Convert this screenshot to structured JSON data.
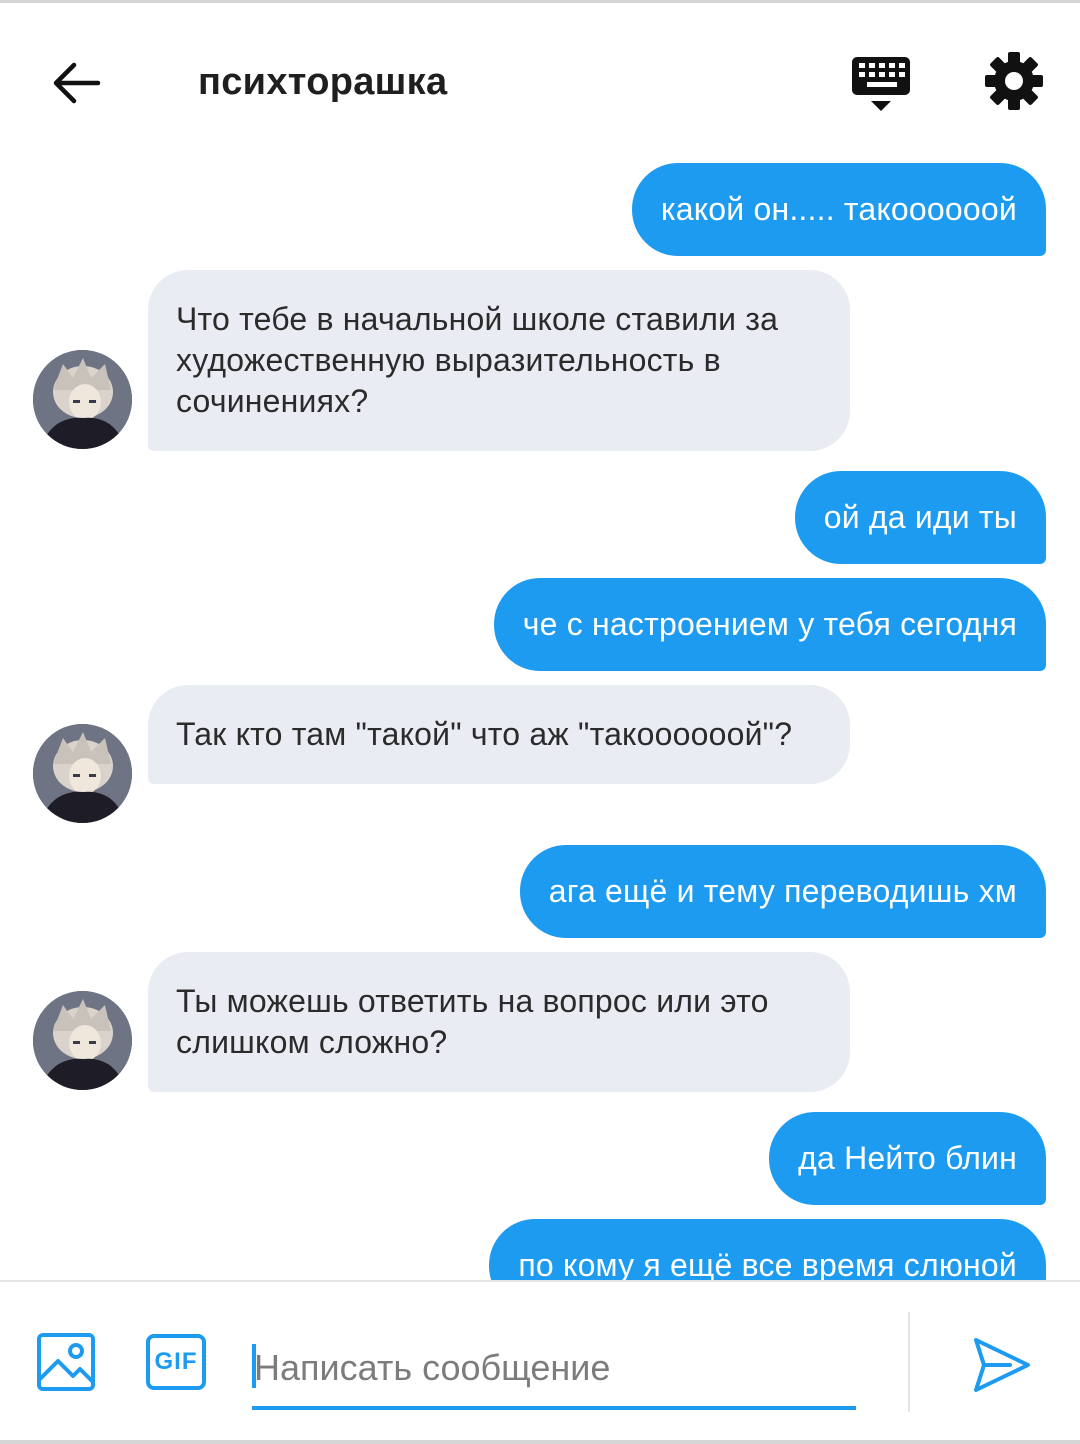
{
  "header": {
    "title": "психторашка",
    "back_icon": "arrow-left-icon",
    "keyboard_icon": "keyboard-hide-icon",
    "settings_icon": "gear-icon"
  },
  "messages": [
    {
      "side": "out",
      "text": "какой он..... такоооооой"
    },
    {
      "side": "in",
      "text": "Что тебе в начальной школе ставили за художественную выразительность в сочинениях?"
    },
    {
      "side": "out",
      "text": "ой да иди ты"
    },
    {
      "side": "out",
      "text": "че с настроением у тебя сегодня"
    },
    {
      "side": "in",
      "text": "Так кто там \"такой\" что аж \"такоооооой\"?"
    },
    {
      "side": "out",
      "text": "ага ещё и тему переводишь хм"
    },
    {
      "side": "in",
      "text": "Ты можешь ответить на вопрос или это слишком сложно?"
    },
    {
      "side": "out",
      "text": "да Нейто блин"
    },
    {
      "side": "out",
      "text": "по кому я ещё все время слюной"
    }
  ],
  "composer": {
    "image_icon": "image-icon",
    "gif_label": "GIF",
    "placeholder": "Написать сообщение",
    "value": "",
    "send_icon": "send-icon"
  },
  "colors": {
    "accent": "#1d9bf0",
    "incoming_bubble": "#e9ecf2",
    "outgoing_text": "#ffffff"
  }
}
